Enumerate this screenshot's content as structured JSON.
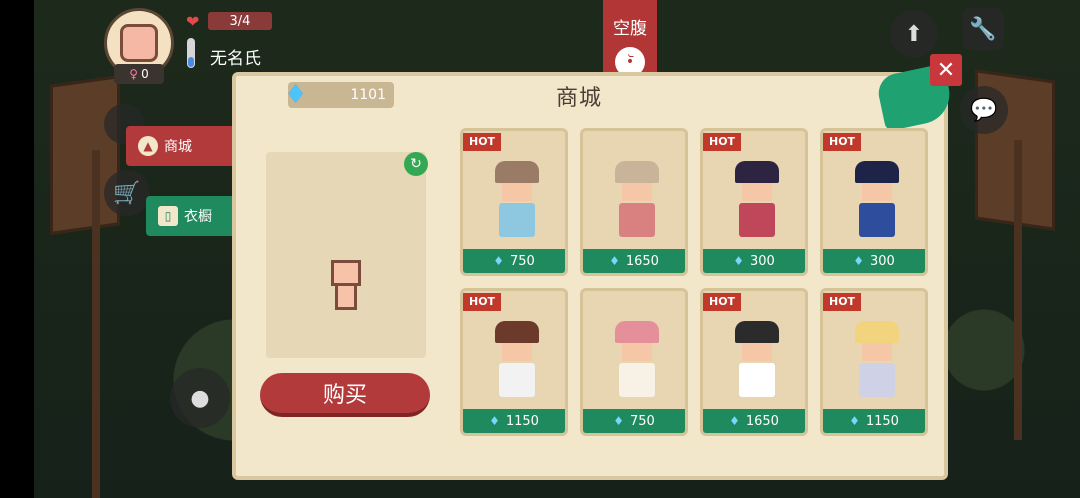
{
  "hud": {
    "hp_text": "3/4",
    "player_name": "无名氏",
    "gender_count": "0",
    "status_label": "空腹"
  },
  "shop": {
    "title": "商城",
    "gem_count": "1101",
    "buy_label": "购买",
    "tabs": [
      {
        "label": "商城",
        "active": true
      },
      {
        "label": "衣橱",
        "active": false
      }
    ],
    "items": [
      {
        "badge": "HOT",
        "price": "750",
        "hair": "#9a7b66",
        "outfit": "#8ec7e0"
      },
      {
        "badge": "",
        "price": "1650",
        "hair": "#c9b49a",
        "outfit": "#d98181"
      },
      {
        "badge": "HOT",
        "price": "300",
        "hair": "#2c2440",
        "outfit": "#c0465a"
      },
      {
        "badge": "HOT",
        "price": "300",
        "hair": "#1e2448",
        "outfit": "#2e4d9c"
      },
      {
        "badge": "HOT",
        "price": "1150",
        "hair": "#6b3a2a",
        "outfit": "#f2f2f2"
      },
      {
        "badge": "",
        "price": "750",
        "hair": "#e48f9a",
        "outfit": "#f7f1e6"
      },
      {
        "badge": "HOT",
        "price": "1650",
        "hair": "#2b2b2b",
        "outfit": "#ffffff"
      },
      {
        "badge": "HOT",
        "price": "1150",
        "hair": "#f2d37e",
        "outfit": "#cfd2e6"
      }
    ]
  },
  "colors": {
    "panel": "#f2e6cb",
    "accent_red": "#b23a3b",
    "accent_green": "#1f8a5d"
  }
}
